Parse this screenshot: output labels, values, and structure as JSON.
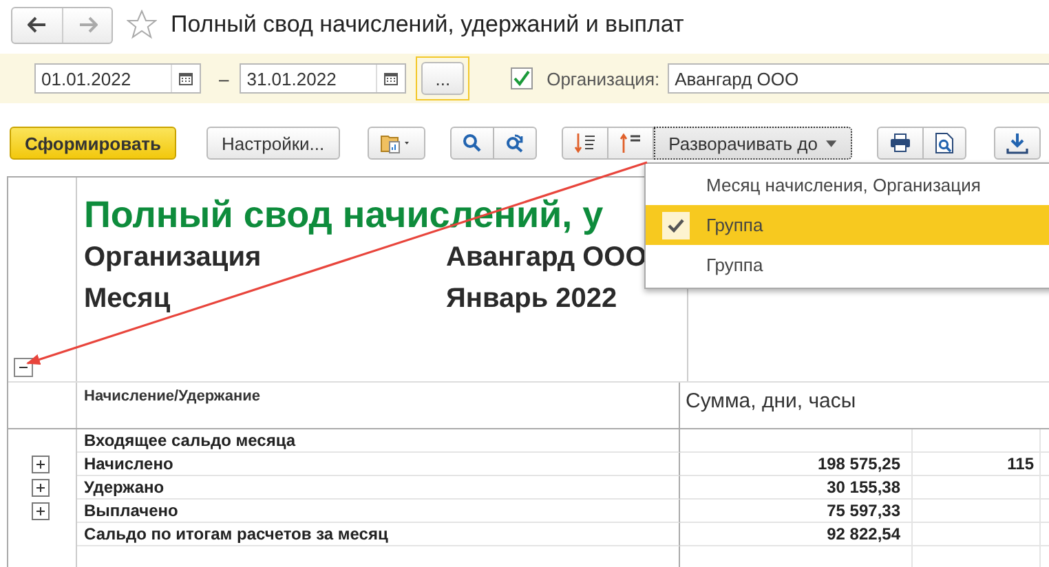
{
  "window": {
    "title": "Полный свод начислений, удержаний и выплат",
    "favorite": false
  },
  "nav": {
    "back_disabled": false,
    "forward_disabled": true
  },
  "filters": {
    "date_from": "01.01.2022",
    "dash": "–",
    "date_to": "31.01.2022",
    "period_button": "...",
    "org_checked": true,
    "org_label": "Организация:",
    "org_value": "Авангард ООО"
  },
  "toolbar": {
    "generate_button": "Сформировать",
    "settings_button": "Настройки...",
    "expand_button": "Разворачивать до"
  },
  "expand_menu": [
    {
      "label": "Месяц начисления, Организация",
      "selected": false
    },
    {
      "label": "Группа",
      "selected": true
    },
    {
      "label": "Группа",
      "selected": false
    }
  ],
  "report": {
    "title": "Полный свод начислений, у",
    "expanded": true,
    "params": [
      {
        "label": "Организация",
        "value": "Авангард ООО"
      },
      {
        "label": "Месяц",
        "value": "Январь 2022"
      }
    ],
    "header": {
      "column_1": "Начисление/Удержание",
      "column_2": "Сумма, дни, часы"
    },
    "rows": [
      {
        "label": "Входящее сальдо месяца",
        "expandable": false,
        "sum": "",
        "column_3": ""
      },
      {
        "label": "Начислено",
        "expandable": true,
        "sum": "198 575,25",
        "column_3": "115"
      },
      {
        "label": "Удержано",
        "expandable": true,
        "sum": "30 155,38",
        "column_3": ""
      },
      {
        "label": "Выплачено",
        "expandable": true,
        "sum": "75 597,33",
        "column_3": ""
      },
      {
        "label": "Сальдо по итогам расчетов за месяц",
        "expandable": false,
        "sum": "92 822,54",
        "column_3": ""
      }
    ]
  }
}
